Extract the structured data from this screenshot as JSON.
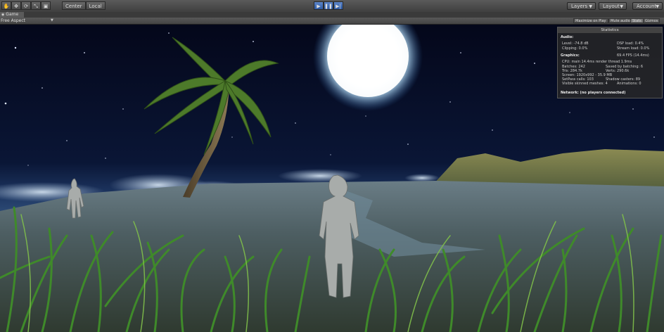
{
  "toolbar": {
    "tools": [
      {
        "name": "hand-tool-icon",
        "glyph": "✋"
      },
      {
        "name": "move-tool-icon",
        "glyph": "✥"
      },
      {
        "name": "rotate-tool-icon",
        "glyph": "⟳"
      },
      {
        "name": "scale-tool-icon",
        "glyph": "⤡"
      },
      {
        "name": "rect-tool-icon",
        "glyph": "▣"
      }
    ],
    "pivot_label": "Center",
    "space_label": "Local",
    "play_icon": "▶",
    "pause_icon": "❚❚",
    "step_icon": "▶|",
    "layers_label": "Layers",
    "layout_label": "Layout",
    "account_label": "Account"
  },
  "tab": {
    "title": "Game",
    "icon": "game-controller-icon"
  },
  "gamebar": {
    "aspect": "Free Aspect",
    "maximize_on_play": "Maximize on Play",
    "mute_audio": "Mute audio",
    "stats": "Stats",
    "gizmos": "Gizmos"
  },
  "stats": {
    "title": "Statistics",
    "audio_header": "Audio:",
    "level": "Level: -74.8 dB",
    "clipping": "Clipping: 0.0%",
    "dsp_load": "DSP load: 0.4%",
    "stream_load": "Stream load: 0.0%",
    "graphics_header": "Graphics:",
    "fps": "69.4 FPS (14.4ms)",
    "cpu": "CPU: main 14.4ms  render thread 1.9ms",
    "batches": "Batches: 242",
    "saved_batching": "Saved by batching: 6",
    "tris": "Tris: 284.7k",
    "verts": "Verts: 290.6k",
    "screen": "Screen: 1920x992 - 35.9 MB",
    "setpass": "SetPass calls: 103",
    "shadow_casters": "Shadow casters: 89",
    "skinned": "Visible skinned meshes: 4",
    "animations": "Animations: 0",
    "network": "Network: (no players connected)"
  },
  "colors": {
    "sky_top": "#05081a",
    "sky_horizon": "#1d3560",
    "moon": "#ffffff",
    "grass": "#3f8a2a",
    "ground": "#4d5a5c",
    "accent_play": "#3a6fc4"
  }
}
